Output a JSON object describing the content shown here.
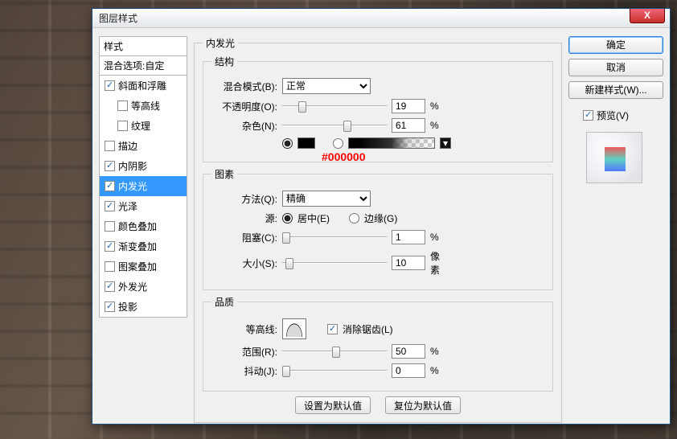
{
  "dialog_title": "图层样式",
  "close_glyph": "X",
  "left": {
    "styles_header": "样式",
    "blend_header": "混合选项:自定",
    "items": [
      {
        "label": "斜面和浮雕",
        "checked": true,
        "sub": false
      },
      {
        "label": "等高线",
        "checked": false,
        "sub": true
      },
      {
        "label": "纹理",
        "checked": false,
        "sub": true
      },
      {
        "label": "描边",
        "checked": false,
        "sub": false
      },
      {
        "label": "内阴影",
        "checked": true,
        "sub": false
      },
      {
        "label": "内发光",
        "checked": true,
        "sub": false,
        "selected": true
      },
      {
        "label": "光泽",
        "checked": true,
        "sub": false
      },
      {
        "label": "颜色叠加",
        "checked": false,
        "sub": false
      },
      {
        "label": "渐变叠加",
        "checked": true,
        "sub": false
      },
      {
        "label": "图案叠加",
        "checked": false,
        "sub": false
      },
      {
        "label": "外发光",
        "checked": true,
        "sub": false
      },
      {
        "label": "投影",
        "checked": true,
        "sub": false
      }
    ]
  },
  "outer_legend": "内发光",
  "struct": {
    "legend": "结构",
    "blend_label": "混合模式(B):",
    "blend_value": "正常",
    "opacity_label": "不透明度(O):",
    "opacity_value": "19",
    "pct": "%",
    "noise_label": "杂色(N):",
    "noise_value": "61",
    "annotation": "#000000"
  },
  "element": {
    "legend": "图素",
    "method_label": "方法(Q):",
    "method_value": "精确",
    "source_label": "源:",
    "source_center": "居中(E)",
    "source_edge": "边缘(G)",
    "choke_label": "阻塞(C):",
    "choke_value": "1",
    "pct": "%",
    "size_label": "大小(S):",
    "size_value": "10",
    "size_unit": "像素"
  },
  "quality": {
    "legend": "品质",
    "contour_label": "等高线:",
    "aa_label": "消除锯齿(L)",
    "range_label": "范围(R):",
    "range_value": "50",
    "pct": "%",
    "jitter_label": "抖动(J):",
    "jitter_value": "0"
  },
  "bottom": {
    "set_default": "设置为默认值",
    "reset_default": "复位为默认值"
  },
  "right": {
    "ok": "确定",
    "cancel": "取消",
    "newstyle": "新建样式(W)...",
    "preview": "预览(V)"
  }
}
